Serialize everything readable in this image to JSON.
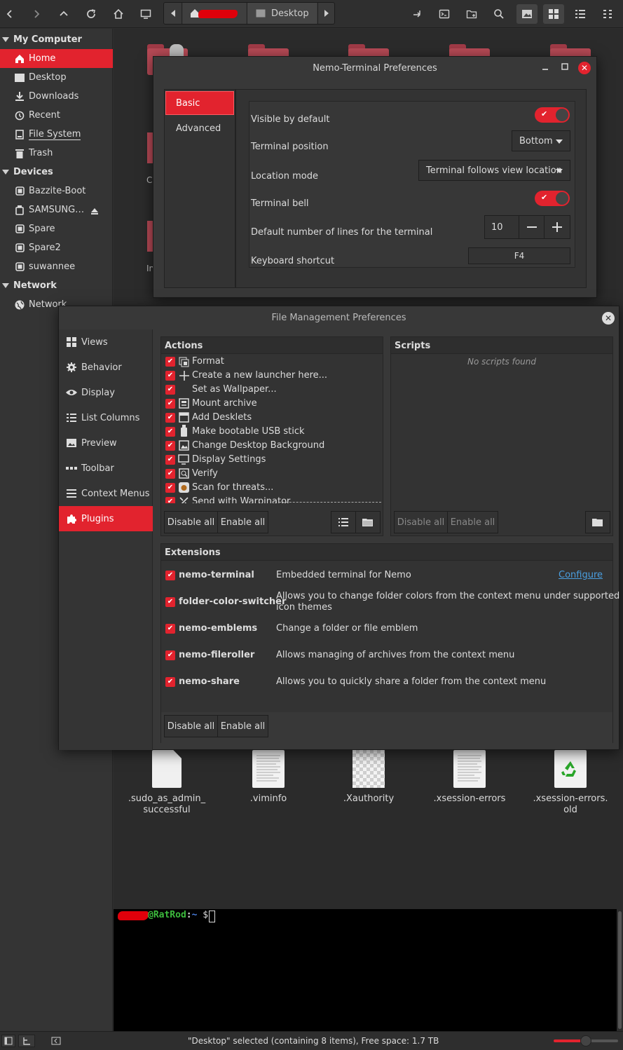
{
  "toolbar": {
    "path_current": "Desktop",
    "buttons": [
      "back-icon",
      "forward-icon",
      "up-icon",
      "reload-icon",
      "home-icon",
      "computer-icon",
      "toggle-location-icon"
    ],
    "right_buttons": [
      "open-terminal-icon",
      "terminal-icon",
      "new-folder-icon",
      "search-icon",
      "view-thumbnails-icon",
      "view-icons-icon",
      "view-list-icon",
      "view-compact-icon"
    ]
  },
  "sidebar": {
    "my_computer": "My Computer",
    "items": [
      {
        "label": "Home",
        "icon": "home-icon"
      },
      {
        "label": "Desktop",
        "icon": "desktop-icon"
      },
      {
        "label": "Downloads",
        "icon": "download-icon"
      },
      {
        "label": "Recent",
        "icon": "clock-icon"
      },
      {
        "label": "File System",
        "icon": "drive-icon"
      },
      {
        "label": "Trash",
        "icon": "trash-icon"
      }
    ],
    "devices": "Devices",
    "device_items": [
      {
        "label": "Bazzite-Boot"
      },
      {
        "label": "SAMSUNG…"
      },
      {
        "label": "Spare"
      },
      {
        "label": "Spare2"
      },
      {
        "label": "suwannee"
      }
    ],
    "network": "Network",
    "network_items": [
      {
        "label": "Network"
      }
    ]
  },
  "content_partial": {
    "c": "C",
    "in": "In"
  },
  "terminal_prefs": {
    "title": "Nemo-Terminal Preferences",
    "nav": [
      "Basic",
      "Advanced"
    ],
    "visible_by_default": "Visible by default",
    "terminal_position": "Terminal position",
    "terminal_position_value": "Bottom",
    "location_mode": "Location mode",
    "location_mode_value": "Terminal follows view location",
    "terminal_bell": "Terminal bell",
    "default_lines": "Default number of lines for the terminal",
    "default_lines_value": "10",
    "keyboard_shortcut": "Keyboard shortcut",
    "keyboard_shortcut_value": "F4"
  },
  "fm_prefs": {
    "title": "File Management Preferences",
    "nav": [
      {
        "label": "Views",
        "icon": "grid-icon"
      },
      {
        "label": "Behavior",
        "icon": "gear-icon"
      },
      {
        "label": "Display",
        "icon": "eye-icon"
      },
      {
        "label": "List Columns",
        "icon": "list-icon"
      },
      {
        "label": "Preview",
        "icon": "image-icon"
      },
      {
        "label": "Toolbar",
        "icon": "dots-icon"
      },
      {
        "label": "Context Menus",
        "icon": "menu-icon"
      },
      {
        "label": "Plugins",
        "icon": "puzzle-icon"
      }
    ],
    "actions_header": "Actions",
    "actions": [
      "Format",
      "Create a new launcher here...",
      "Set as Wallpaper...",
      "Mount archive",
      "Add Desklets",
      "Make bootable USB stick",
      "Change Desktop Background",
      "Display Settings",
      "Verify",
      "Scan for threats...",
      "Send with Warpinator"
    ],
    "scripts_header": "Scripts",
    "no_scripts": "No scripts found",
    "disable_all": "Disable all",
    "enable_all": "Enable all",
    "extensions_header": "Extensions",
    "extensions": [
      {
        "name": "nemo-terminal",
        "desc": "Embedded terminal for Nemo",
        "link": "Configure"
      },
      {
        "name": "folder-color-switcher",
        "desc": "Allows you to change folder colors from the context menu under supported",
        "desc2": "icon themes"
      },
      {
        "name": "nemo-emblems",
        "desc": "Change a folder or file emblem"
      },
      {
        "name": "nemo-fileroller",
        "desc": "Allows managing of archives from the context menu"
      },
      {
        "name": "nemo-share",
        "desc": "Allows you to quickly share a folder from the context menu"
      }
    ]
  },
  "files": [
    {
      "name1": ".sudo_as_admin_",
      "name2": "successful"
    },
    {
      "name1": ".viminfo",
      "name2": ""
    },
    {
      "name1": ".Xauthority",
      "name2": ""
    },
    {
      "name1": ".xsession-errors",
      "name2": ""
    },
    {
      "name1": ".xsession-errors.",
      "name2": "old"
    }
  ],
  "terminal": {
    "host": "@RatRod",
    "sep": ":",
    "path": "~",
    "prompt": "$"
  },
  "statusbar": {
    "text": "\"Desktop\" selected (containing 8 items), Free space: 1.7 TB"
  },
  "colors": {
    "accent": "#e2232e",
    "bg": "#2e2e2e",
    "link": "#4a9fe0",
    "term_green": "#3dbb3d"
  }
}
